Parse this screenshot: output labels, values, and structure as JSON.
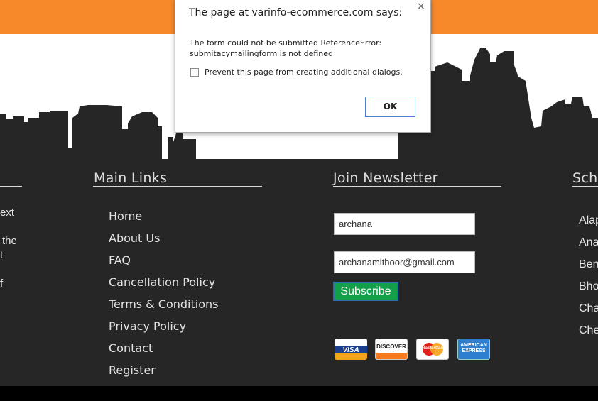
{
  "dialog": {
    "title": "The page at varinfo-ecommerce.com says:",
    "close_glyph": "×",
    "message_line1": "The form could not be submitted ReferenceError:",
    "message_line2": "submitacymailingform is not defined",
    "checkbox_label": "Prevent this page from creating additional dialogs.",
    "checkbox_checked": false,
    "ok_label": "OK"
  },
  "footer": {
    "left_column_fragments": [
      "ext",
      "the",
      "t",
      "f"
    ],
    "main_links": {
      "title": "Main Links",
      "items": [
        "Home",
        "About Us",
        "FAQ",
        "Cancellation Policy",
        "Terms & Conditions",
        "Privacy Policy",
        "Contact",
        "Register"
      ]
    },
    "newsletter": {
      "title": "Join Newsletter",
      "name_value": "archana",
      "email_value": "archanamithoor@gmail.com",
      "subscribe_label": "Subscribe",
      "payment_icons": [
        "visa-card-icon",
        "discover-card-icon",
        "mastercard-icon",
        "american-express-icon"
      ],
      "card_labels": {
        "visa": "VISA",
        "discover": "DISCOVER",
        "mastercard": "MasterCard",
        "amex_line1": "AMERICAN",
        "amex_line2": "EXPRESS"
      }
    },
    "schools": {
      "title_fragment": "Scho",
      "items": [
        "Alap",
        "Ana",
        "Ben",
        "Bho",
        "Cha",
        "Che"
      ]
    }
  },
  "colors": {
    "top_bar": "#f7892a",
    "footer_bg": "#262626",
    "subscribe_bg": "#13a04a"
  }
}
